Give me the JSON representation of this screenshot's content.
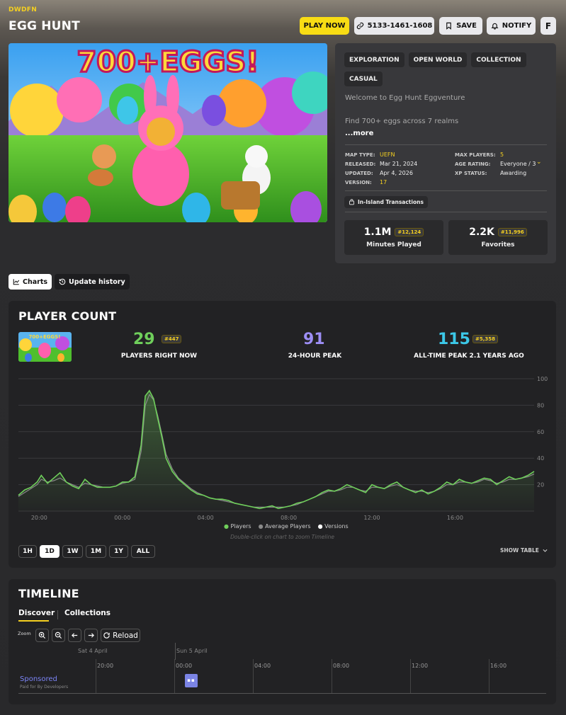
{
  "header": {
    "brand": "DWDFN",
    "title": "EGG HUNT",
    "play_label": "PLAY NOW",
    "island_code": "5133-1461-1608",
    "save_label": "SAVE",
    "notify_label": "NOTIFY",
    "f_label": "F"
  },
  "hero": {
    "banner_text": "700+EGGS!"
  },
  "info": {
    "tags": [
      "EXPLORATION",
      "OPEN WORLD",
      "COLLECTION",
      "CASUAL"
    ],
    "desc_line1": "Welcome to Egg Hunt Eggventure",
    "desc_line2": "Find 700+ eggs across 7 realms",
    "more_label": "...more",
    "meta": {
      "map_type_key": "MAP TYPE:",
      "map_type": "UEFN",
      "released_key": "RELEASED:",
      "released": "Mar 21, 2024",
      "updated_key": "UPDATED:",
      "updated": "Apr 4, 2026",
      "version_key": "VERSION:",
      "version": "17",
      "max_players_key": "MAX PLAYERS:",
      "max_players": "5",
      "age_rating_key": "AGE RATING:",
      "age_rating": "Everyone / 3",
      "xp_status_key": "XP STATUS:",
      "xp_status": "Awarding"
    },
    "transactions_label": "In-Island Transactions",
    "minutes_played": "1.1M",
    "minutes_rank": "#12,124",
    "minutes_label": "Minutes Played",
    "favorites": "2.2K",
    "favorites_rank": "#11,996",
    "favorites_label": "Favorites"
  },
  "tabs": {
    "charts": "Charts",
    "update_history": "Update history"
  },
  "player_count": {
    "title": "PLAYER COUNT",
    "now": "29",
    "now_rank": "#447",
    "now_label": "PLAYERS RIGHT NOW",
    "peak24": "91",
    "peak24_label": "24-HOUR PEAK",
    "alltime": "115",
    "alltime_rank": "#5,358",
    "alltime_label": "ALL-TIME PEAK 2.1 YEARS AGO",
    "legend": {
      "players": "Players",
      "average": "Average Players",
      "versions": "Versions"
    },
    "hint": "Double-click on chart to zoom Timeline",
    "ranges": [
      "1H",
      "1D",
      "1W",
      "1M",
      "1Y",
      "ALL"
    ],
    "selected_range": "1D",
    "show_table": "SHOW TABLE"
  },
  "chart_data": {
    "type": "line",
    "x_ticks": [
      "20:00",
      "00:00",
      "04:00",
      "08:00",
      "12:00",
      "16:00"
    ],
    "y_ticks": [
      20,
      40,
      60,
      80,
      100
    ],
    "ylim": [
      0,
      100
    ],
    "grid": true,
    "legend_position": "bottom",
    "colors": {
      "players": "#6fcf5b",
      "average": "#8a8a8a"
    },
    "x_hours": [
      -5.0,
      -4.7,
      -4.4,
      -4.1,
      -3.9,
      -3.6,
      -3.3,
      -3.0,
      -2.7,
      -2.4,
      -2.1,
      -1.8,
      -1.5,
      -1.2,
      -0.9,
      -0.6,
      -0.3,
      0.0,
      0.3,
      0.6,
      0.9,
      1.1,
      1.3,
      1.5,
      1.7,
      1.9,
      2.1,
      2.4,
      2.7,
      3.0,
      3.3,
      3.6,
      3.9,
      4.2,
      4.5,
      4.8,
      5.1,
      5.4,
      5.7,
      6.0,
      6.3,
      6.6,
      6.9,
      7.2,
      7.5,
      7.8,
      8.1,
      8.4,
      8.7,
      9.0,
      9.3,
      9.6,
      9.9,
      10.2,
      10.5,
      10.8,
      11.1,
      11.4,
      11.7,
      12.0,
      12.3,
      12.6,
      12.9,
      13.2,
      13.5,
      13.8,
      14.1,
      14.4,
      14.7,
      15.0,
      15.3,
      15.6,
      15.9,
      16.2,
      16.5,
      16.8,
      17.1,
      17.4,
      17.7,
      18.0,
      18.3,
      18.6,
      18.9,
      19.2,
      19.5,
      19.8
    ],
    "series": [
      {
        "name": "Players",
        "values": [
          12,
          16,
          18,
          22,
          27,
          21,
          25,
          29,
          22,
          19,
          17,
          24,
          20,
          18,
          18,
          18,
          19,
          22,
          22,
          26,
          50,
          87,
          91,
          85,
          70,
          56,
          40,
          30,
          24,
          20,
          16,
          13,
          12,
          10,
          9,
          9,
          8,
          6,
          5,
          4,
          3,
          2,
          3,
          4,
          2,
          3,
          4,
          6,
          7,
          9,
          11,
          14,
          16,
          15,
          17,
          20,
          18,
          16,
          14,
          20,
          18,
          17,
          20,
          22,
          18,
          16,
          14,
          16,
          13,
          15,
          18,
          22,
          20,
          24,
          22,
          21,
          23,
          25,
          24,
          20,
          23,
          26,
          24,
          25,
          27,
          30
        ]
      },
      {
        "name": "Average Players",
        "values": [
          11,
          14,
          17,
          20,
          24,
          22,
          23,
          25,
          22,
          20,
          18,
          21,
          20,
          19,
          18,
          18,
          19,
          21,
          22,
          24,
          45,
          80,
          88,
          84,
          72,
          58,
          43,
          32,
          25,
          21,
          17,
          14,
          12,
          10,
          9,
          8,
          7,
          6,
          5,
          4,
          3,
          3,
          3,
          3,
          3,
          3,
          4,
          5,
          7,
          9,
          11,
          13,
          15,
          15,
          16,
          18,
          18,
          16,
          15,
          18,
          18,
          17,
          19,
          20,
          18,
          16,
          15,
          15,
          14,
          15,
          17,
          20,
          20,
          22,
          22,
          21,
          22,
          24,
          23,
          21,
          22,
          24,
          24,
          25,
          26,
          28
        ]
      }
    ]
  },
  "timeline": {
    "title": "TIMELINE",
    "tab_discover": "Discover",
    "tab_collections": "Collections",
    "zoom_label": "Zoom",
    "reload_label": "Reload",
    "date1": "Sat 4 April",
    "date2": "Sun 5 April",
    "ticks": [
      "20:00",
      "00:00",
      "04:00",
      "08:00",
      "12:00",
      "16:00"
    ],
    "sponsored": "Sponsored",
    "sponsored_sub": "Paid for By Developers"
  }
}
